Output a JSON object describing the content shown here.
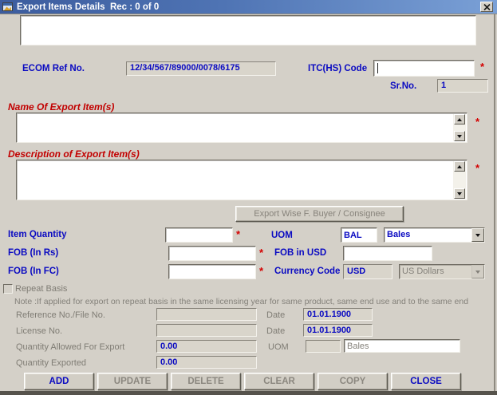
{
  "titlebar": {
    "title": "Export Items Details  Rec : 0 of 0"
  },
  "required_marker": "*",
  "header": {
    "textbox_value": "",
    "ecom_label": "ECOM Ref No.",
    "ecom_value": "12/34/567/89000/0078/6175",
    "itc_label": "ITC(HS) Code",
    "itc_value": "",
    "srno_label": "Sr.No.",
    "srno_value": "1"
  },
  "sections": {
    "name_label": "Name Of Export Item(s)",
    "name_value": "",
    "desc_label": "Description of Export Item(s)",
    "desc_value": "",
    "export_wise_button": "Export Wise F. Buyer / Consignee"
  },
  "quantity": {
    "item_qty_label": "Item Quantity",
    "item_qty_value": "",
    "uom_label": "UOM",
    "uom_code": "BAL",
    "uom_selected": "Bales",
    "fob_rs_label": "FOB (In Rs)",
    "fob_rs_value": "",
    "fob_usd_label": "FOB in USD",
    "fob_usd_value": "",
    "fob_fc_label": "FOB (In FC)",
    "fob_fc_value": "",
    "currency_label": "Currency Code",
    "currency_code": "USD",
    "currency_selected": "US Dollars"
  },
  "repeat": {
    "checkbox_label": "Repeat Basis",
    "checkbox_checked": false,
    "note": "Note :If applied for export on repeat basis in the same licensing year for same product, same end use and to the same end",
    "reference_label": "Reference No./File No.",
    "reference_value": "",
    "date_label": "Date",
    "reference_date": "01.01.1900",
    "license_label": "License No.",
    "license_value": "",
    "license_date": "01.01.1900",
    "qty_allowed_label": "Quantity Allowed For Export",
    "qty_allowed_value": "0.00",
    "uom2_label": "UOM",
    "uom2_code": "",
    "uom2_name": "Bales",
    "qty_exported_label": "Quantity Exported",
    "qty_exported_value": "0.00"
  },
  "actions": {
    "add": "ADD",
    "update": "UPDATE",
    "delete": "DELETE",
    "clear": "CLEAR",
    "copy": "COPY",
    "close": "CLOSE"
  },
  "colors": {
    "window_bg": "#d4d0c8",
    "label_blue": "#0a0ac2",
    "required_red": "#d40000",
    "titlebar_start": "#3c5c9e",
    "titlebar_end": "#7aa0d6",
    "disabled_text": "#84817a"
  }
}
